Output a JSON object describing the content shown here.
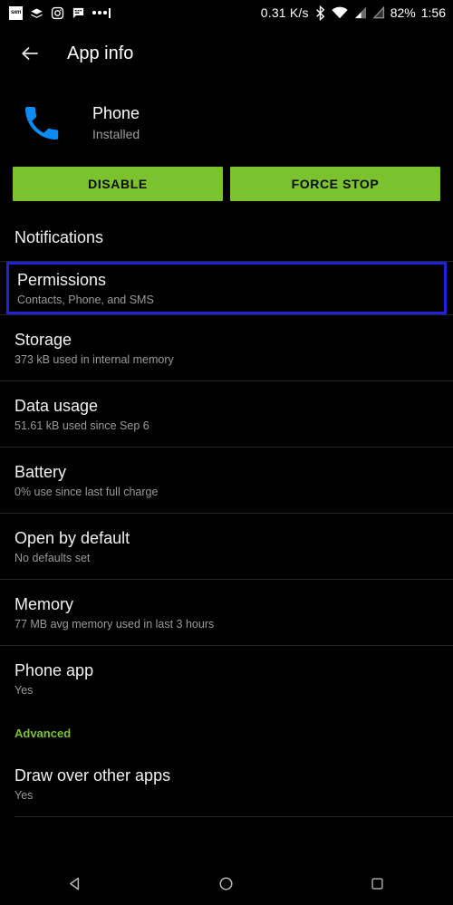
{
  "status_bar": {
    "notification_icons": [
      {
        "name": "sxm-icon",
        "label": "sxm"
      },
      {
        "name": "layers-icon",
        "label": ""
      },
      {
        "name": "instagram-icon",
        "label": ""
      },
      {
        "name": "chat-icon",
        "label": ""
      },
      {
        "name": "more-notifications-icon",
        "label": "•••"
      }
    ],
    "network_speed": "0.31 K/s",
    "bluetooth_icon": "bluetooth-icon",
    "wifi_icon": "wifi-icon",
    "signal_icon": "cell-signal-icon",
    "no_sim_icon": "no-sim-icon",
    "battery_percent": "82%",
    "clock": "1:56"
  },
  "app_bar": {
    "back_icon": "back-arrow-icon",
    "title": "App info"
  },
  "app_header": {
    "icon": "phone-app-icon",
    "icon_color": "#0a8cf5",
    "name": "Phone",
    "state": "Installed"
  },
  "actions": {
    "disable_label": "DISABLE",
    "force_stop_label": "FORCE STOP",
    "button_color": "#7ac32e"
  },
  "settings_rows": [
    {
      "title": "Notifications",
      "subtitle": "",
      "selected": false
    },
    {
      "title": "Permissions",
      "subtitle": "Contacts, Phone, and SMS",
      "selected": true
    },
    {
      "title": "Storage",
      "subtitle": "373 kB used in internal memory",
      "selected": false
    },
    {
      "title": "Data usage",
      "subtitle": "51.61 kB used since Sep 6",
      "selected": false
    },
    {
      "title": "Battery",
      "subtitle": "0% use since last full charge",
      "selected": false
    },
    {
      "title": "Open by default",
      "subtitle": "No defaults set",
      "selected": false
    },
    {
      "title": "Memory",
      "subtitle": "77 MB avg memory used in last 3 hours",
      "selected": false
    },
    {
      "title": "Phone app",
      "subtitle": "Yes",
      "selected": false
    }
  ],
  "advanced_section": {
    "header": "Advanced",
    "header_color": "#7ac32e",
    "rows": [
      {
        "title": "Draw over other apps",
        "subtitle": "Yes"
      }
    ]
  },
  "selection_highlight_color": "#2222dd",
  "nav_bar": {
    "back_icon": "nav-back-triangle-icon",
    "home_icon": "nav-home-circle-icon",
    "recents_icon": "nav-recents-square-icon"
  }
}
